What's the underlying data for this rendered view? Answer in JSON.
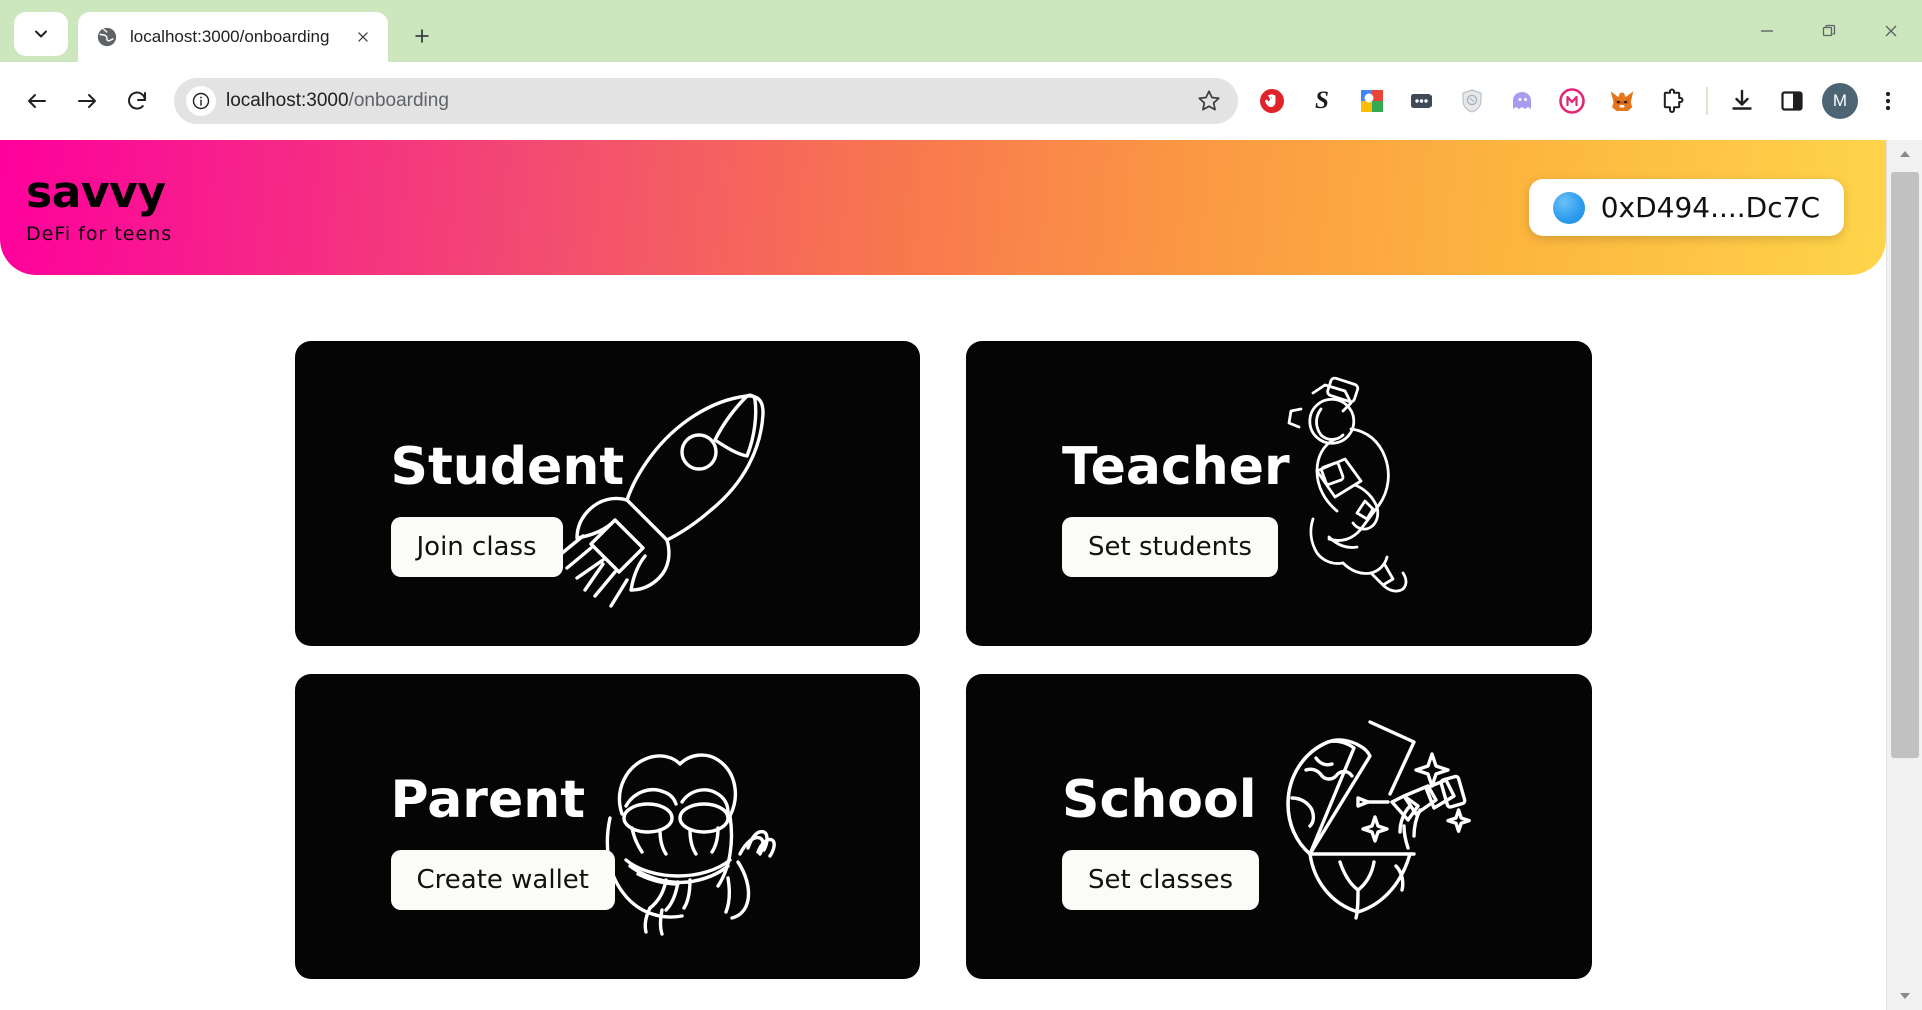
{
  "browser": {
    "tab_search_icon": "chevron-down-icon",
    "tab": {
      "favicon": "globe-icon",
      "title": "localhost:3000/onboarding",
      "close_icon": "close-icon"
    },
    "new_tab_icon": "plus-icon",
    "window_controls": {
      "minimize": "minimize-icon",
      "maximize": "restore-icon",
      "close": "close-icon"
    },
    "nav": {
      "back": "back-arrow-icon",
      "forward": "forward-arrow-icon",
      "reload": "reload-icon"
    },
    "omnibox": {
      "info_icon": "site-info-icon",
      "url_host": "localhost:3000",
      "url_path": "/onboarding",
      "url_full": "localhost:3000/onboarding",
      "bookmark_icon": "star-icon"
    },
    "extensions": [
      {
        "name": "adblock-icon",
        "label": "AdBlock"
      },
      {
        "name": "stripe-s-icon",
        "label": "S"
      },
      {
        "name": "google-translate-icon",
        "label": "Google"
      },
      {
        "name": "password-manager-icon",
        "label": "Password manager"
      },
      {
        "name": "shield-privacy-icon",
        "label": "Privacy shield"
      },
      {
        "name": "ghost-extension-icon",
        "label": "Ghostery"
      },
      {
        "name": "magic-eden-icon",
        "label": "Magic Eden"
      },
      {
        "name": "metamask-fox-icon",
        "label": "MetaMask"
      },
      {
        "name": "puzzle-extensions-icon",
        "label": "Extensions"
      }
    ],
    "downloads_icon": "download-icon",
    "sidepanel_icon": "side-panel-icon",
    "profile_initial": "M",
    "menu_icon": "three-dot-menu-icon",
    "scrollbar": {
      "up_icon": "scroll-up-arrow-icon",
      "down_icon": "scroll-down-arrow-icon"
    }
  },
  "app": {
    "brand": {
      "logo": "savvy",
      "tagline": "DeFi for teens"
    },
    "wallet": {
      "avatar_icon": "wallet-avatar-circle",
      "address": "0xD494....Dc7C"
    },
    "colors": {
      "gradient_start": "#ff009d",
      "gradient_mid": "#fb9a43",
      "gradient_end": "#ffd54a",
      "card_bg": "#050505",
      "button_bg": "#fbfbf8"
    },
    "cards": [
      {
        "title": "Student",
        "button": "Join class",
        "art": "rocket-illustration"
      },
      {
        "title": "Teacher",
        "button": "Set students",
        "art": "astronaut-illustration"
      },
      {
        "title": "Parent",
        "button": "Create wallet",
        "art": "frog-illustration"
      },
      {
        "title": "School",
        "button": "Set classes",
        "art": "globe-telescope-illustration"
      }
    ]
  }
}
